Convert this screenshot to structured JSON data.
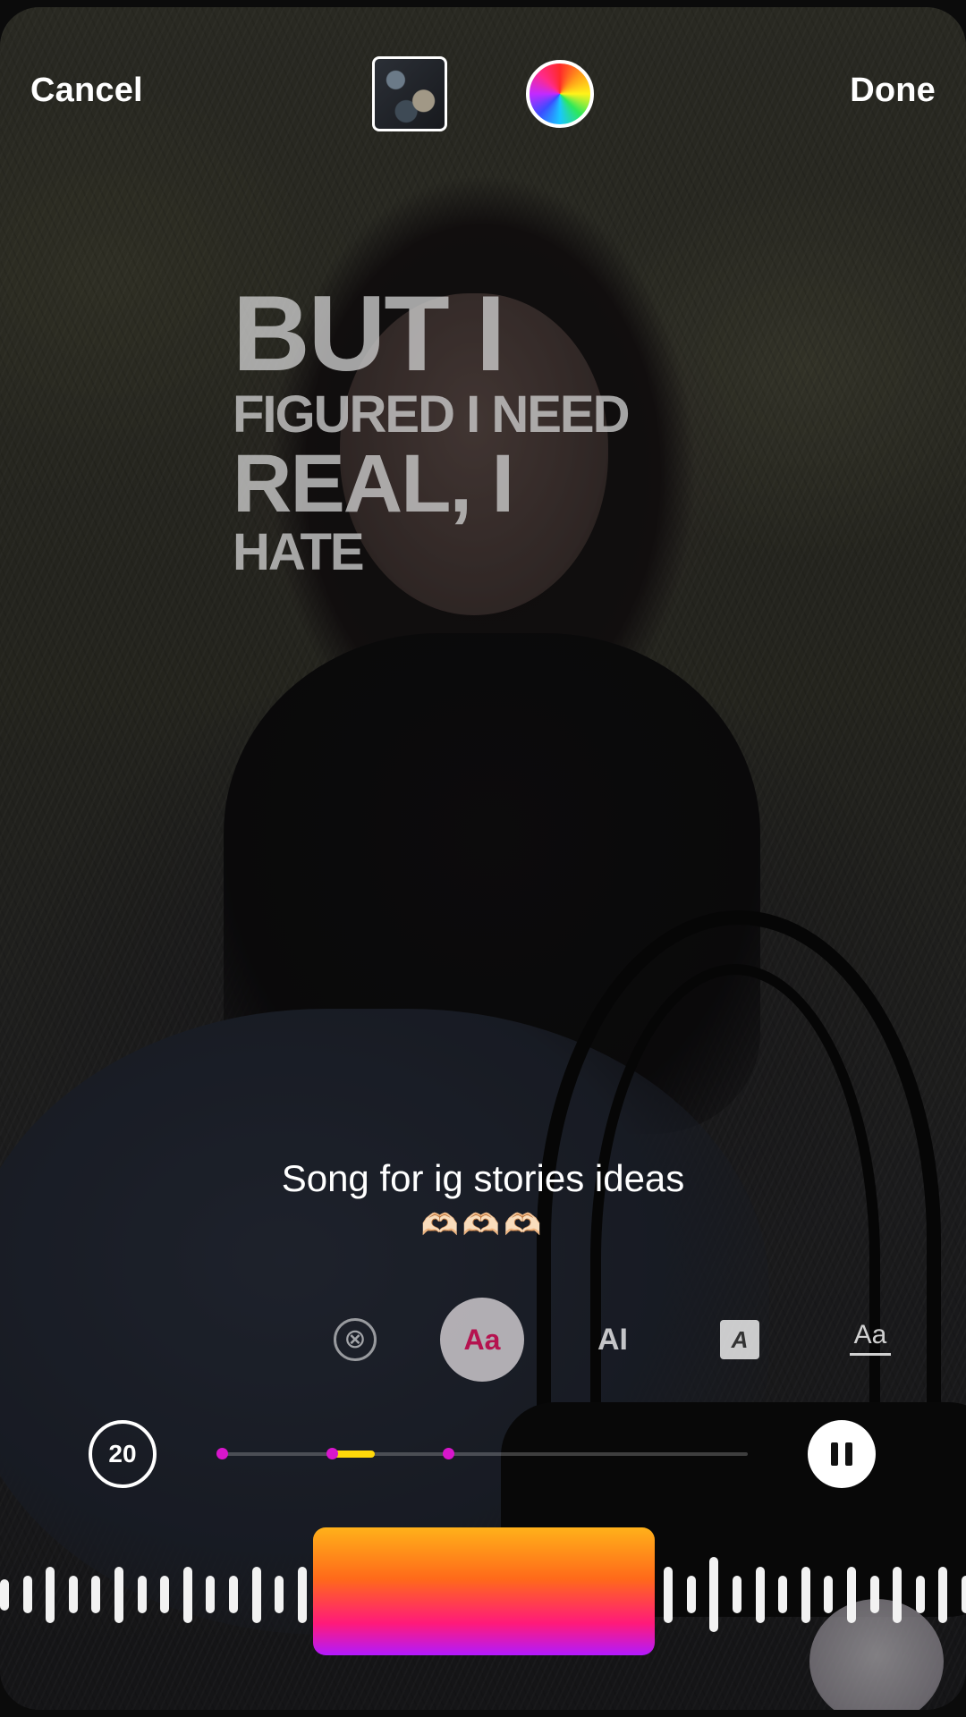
{
  "header": {
    "cancel_label": "Cancel",
    "done_label": "Done",
    "album_art_icon": "album-cover",
    "color_picker_icon": "color-wheel"
  },
  "lyrics": {
    "line1": "BUT I",
    "line2": "FIGURED I NEED",
    "line3": "REAL, I",
    "line4": "HATE"
  },
  "caption": {
    "text": "Song for ig stories ideas",
    "emoji": "🫶🏻🫶🏻🫶🏻"
  },
  "style_picker": {
    "options": [
      {
        "icon": "close-circle-icon",
        "label": "⊗"
      },
      {
        "label": "Aa",
        "selected": true
      },
      {
        "label": "AI"
      },
      {
        "label": "A"
      },
      {
        "label": "Aa"
      }
    ],
    "selected_color": "#b5124f"
  },
  "playback": {
    "duration_seconds": "20",
    "pause_icon": "pause-icon",
    "segment_color": "#ffd80a",
    "marker_color": "#d816cc",
    "segment_start_fraction": 0.21,
    "segment_end_fraction": 0.29,
    "marker_fractions": [
      0.0,
      0.21,
      0.43
    ]
  },
  "waveform": {
    "selection_gradient": [
      "#ffb11a",
      "#ff6a1a",
      "#ff1a7a",
      "#b21aff"
    ],
    "bar_heights": [
      0.25,
      0.3,
      0.45,
      0.3,
      0.3,
      0.45,
      0.3,
      0.3,
      0.45,
      0.3,
      0.3,
      0.45,
      0.3,
      0.45,
      0.3,
      0.6,
      0.3,
      0.45,
      0.3,
      0.6,
      0.3,
      0.45,
      0.3,
      0.6,
      0.3,
      0.45,
      0.3,
      0.6,
      0.3,
      0.45,
      0.3,
      0.6,
      0.3,
      0.45,
      0.3,
      0.45,
      0.3,
      0.45,
      0.3,
      0.45,
      0.3,
      0.45,
      0.3
    ]
  }
}
